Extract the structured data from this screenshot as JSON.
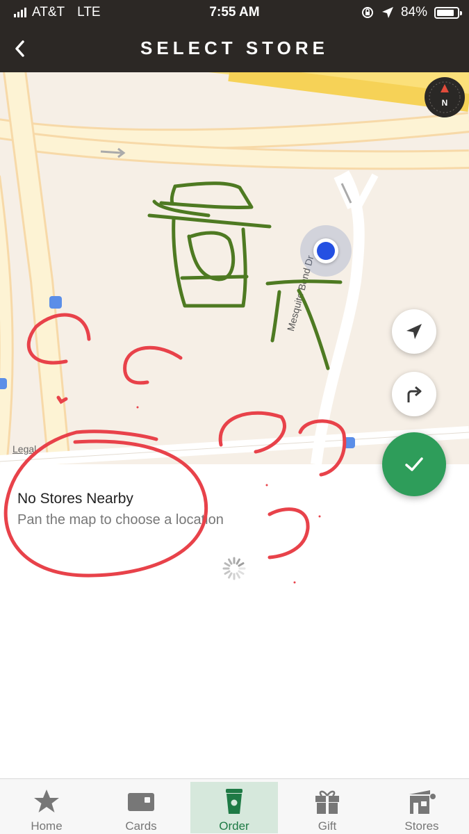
{
  "status_bar": {
    "carrier": "AT&T",
    "network": "LTE",
    "time": "7:55 AM",
    "battery_percent": "84%",
    "battery_level": 0.84,
    "icons": [
      "signal-bars-icon",
      "orientation-lock-icon",
      "location-arrow-icon",
      "battery-icon"
    ]
  },
  "header": {
    "title": "SELECT STORE",
    "back_icon": "chevron-left-icon"
  },
  "map": {
    "street_label": "Mesquite Bend Dr",
    "legal_label": "Legal",
    "compass_label": "N",
    "buttons": [
      "location-arrow-icon",
      "directions-icon",
      "checkmark-icon"
    ]
  },
  "store_message": {
    "title": "No Stores Nearby",
    "subtitle": "Pan the map to choose a location"
  },
  "tabs": [
    {
      "label": "Home",
      "icon": "star-icon"
    },
    {
      "label": "Cards",
      "icon": "card-icon"
    },
    {
      "label": "Order",
      "icon": "cup-icon",
      "active": true
    },
    {
      "label": "Gift",
      "icon": "gift-icon"
    },
    {
      "label": "Stores",
      "icon": "store-icon"
    }
  ],
  "colors": {
    "header_bg": "#2c2825",
    "accent_green": "#2e9d5a",
    "user_location": "#2450e2",
    "scribble_red": "#e8424a",
    "scribble_green": "#4e7a22"
  }
}
